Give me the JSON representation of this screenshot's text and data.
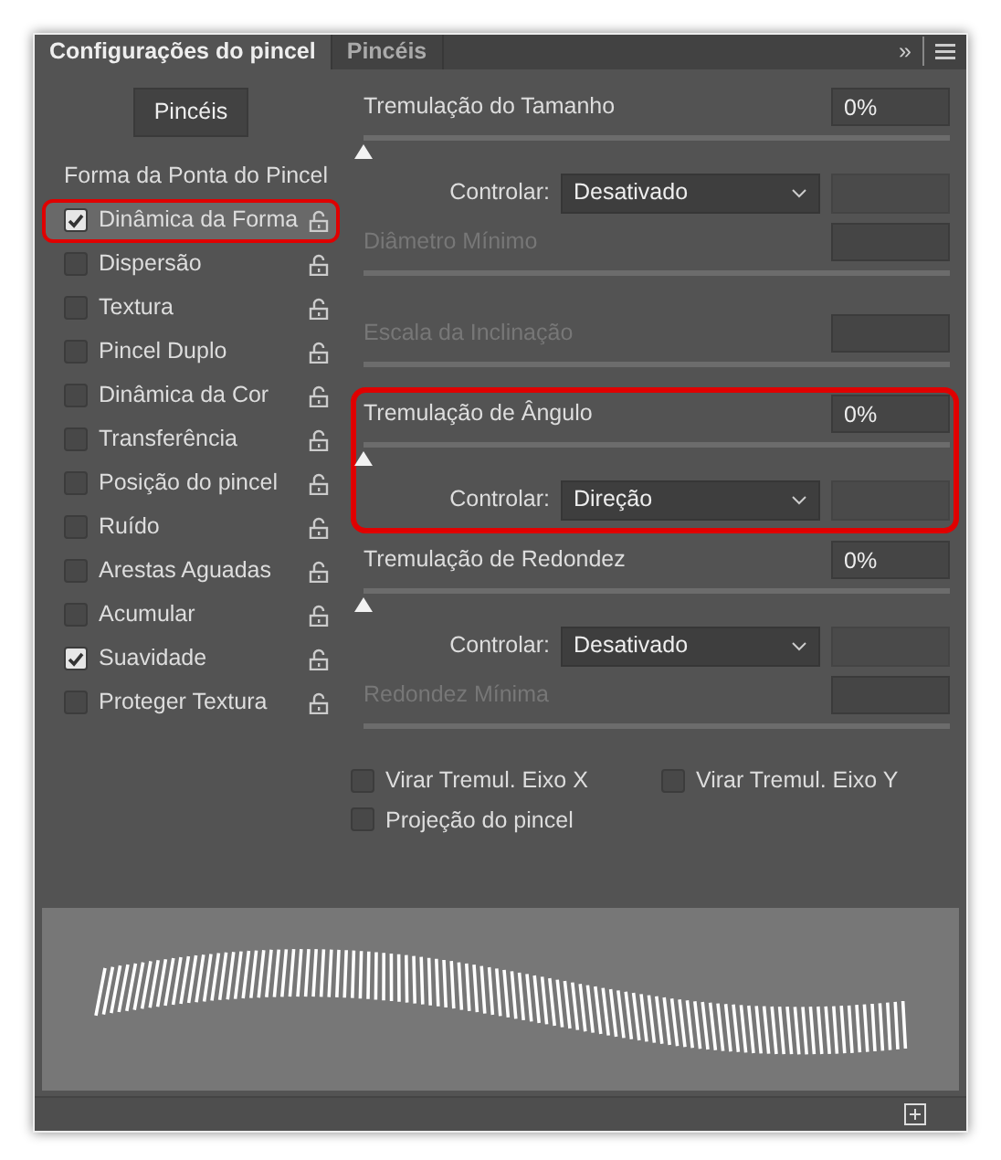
{
  "tabs": [
    {
      "label": "Configurações do pincel",
      "selected": true
    },
    {
      "label": "Pincéis",
      "selected": false
    }
  ],
  "header_icons": [
    "»"
  ],
  "brushes_button": "Pincéis",
  "options": [
    {
      "kind": "header",
      "label": "Forma da Ponta do Pincel",
      "selected": false,
      "highlighted": false
    },
    {
      "kind": "option",
      "label": "Dinâmica da Forma",
      "checked": true,
      "selected": true,
      "highlighted": true
    },
    {
      "kind": "option",
      "label": "Dispersão",
      "checked": false,
      "selected": false,
      "highlighted": false
    },
    {
      "kind": "option",
      "label": "Textura",
      "checked": false,
      "selected": false,
      "highlighted": false
    },
    {
      "kind": "option",
      "label": "Pincel Duplo",
      "checked": false,
      "selected": false,
      "highlighted": false
    },
    {
      "kind": "option",
      "label": "Dinâmica da Cor",
      "checked": false,
      "selected": false,
      "highlighted": false
    },
    {
      "kind": "option",
      "label": "Transferência",
      "checked": false,
      "selected": false,
      "highlighted": false
    },
    {
      "kind": "option",
      "label": "Posição do pincel",
      "checked": false,
      "selected": false,
      "highlighted": false
    },
    {
      "kind": "option",
      "label": "Ruído",
      "checked": false,
      "selected": false,
      "highlighted": false
    },
    {
      "kind": "option",
      "label": "Arestas Aguadas",
      "checked": false,
      "selected": false,
      "highlighted": false
    },
    {
      "kind": "option",
      "label": "Acumular",
      "checked": false,
      "selected": false,
      "highlighted": false
    },
    {
      "kind": "option",
      "label": "Suavidade",
      "checked": true,
      "selected": false,
      "highlighted": false
    },
    {
      "kind": "option",
      "label": "Proteger Textura",
      "checked": false,
      "selected": false,
      "highlighted": false
    }
  ],
  "settings": [
    {
      "highlighted": false,
      "rows": [
        {
          "kind": "slider",
          "label": "Tremulação do Tamanho",
          "value": "0%",
          "level": 0,
          "disabled": false
        },
        {
          "kind": "control",
          "label": "Controlar:",
          "value": "Desativado"
        },
        {
          "kind": "slider",
          "label": "Diâmetro Mínimo",
          "disabled": true
        },
        {
          "kind": "slider",
          "label": "Escala da Inclinação",
          "disabled": true
        }
      ]
    },
    {
      "highlighted": true,
      "rows": [
        {
          "kind": "slider",
          "label": "Tremulação de Ângulo",
          "value": "0%",
          "level": 0,
          "disabled": false
        },
        {
          "kind": "control",
          "label": "Controlar:",
          "value": "Direção"
        }
      ]
    },
    {
      "highlighted": false,
      "rows": [
        {
          "kind": "slider",
          "label": "Tremulação de Redondez",
          "value": "0%",
          "level": 0,
          "disabled": false
        },
        {
          "kind": "control",
          "label": "Controlar:",
          "value": "Desativado"
        },
        {
          "kind": "slider",
          "label": "Redondez Mínima",
          "disabled": true
        }
      ]
    }
  ],
  "flip_options": [
    {
      "label": "Virar Tremul. Eixo X",
      "checked": false
    },
    {
      "label": "Virar Tremul. Eixo Y",
      "checked": false
    },
    {
      "label": "Projeção do pincel",
      "checked": false
    }
  ]
}
